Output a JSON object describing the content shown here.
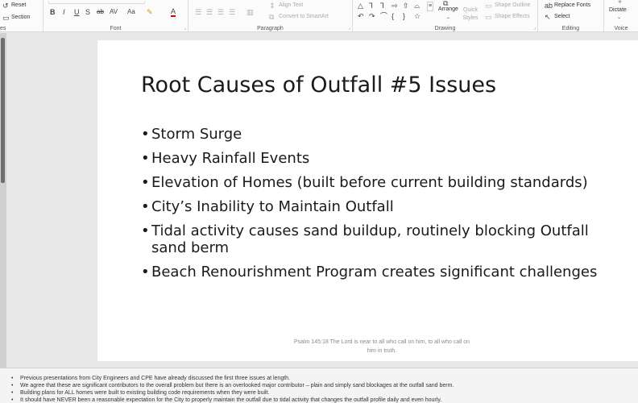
{
  "ribbon": {
    "slides_group": {
      "reset": "Reset",
      "section": "Section",
      "label_fragment": "es"
    },
    "font_group": {
      "label": "Font",
      "buttons": [
        "B",
        "I",
        "U",
        "S",
        "ab",
        "AV",
        "Aa",
        "A"
      ]
    },
    "paragraph_group": {
      "label": "Paragraph",
      "align_text": "Align Text",
      "convert_smartart": "Convert to SmartArt"
    },
    "drawing_group": {
      "label": "Drawing",
      "arrange": "Arrange",
      "quick_styles": "Quick Styles",
      "shape_outline": "Shape Outline",
      "shape_effects": "Shape Effects"
    },
    "editing_group": {
      "label": "Editing",
      "replace_fonts": "Replace Fonts",
      "select": "Select"
    },
    "voice_group": {
      "label": "Voice",
      "dictate": "Dictate"
    }
  },
  "slide": {
    "title": "Root Causes of Outfall #5 Issues",
    "bullets": [
      "Storm Surge",
      "Heavy Rainfall Events",
      "Elevation of Homes (built before current building standards)",
      "City’s Inability to Maintain Outfall",
      "Tidal activity causes sand buildup, routinely blocking Outfall sand berm",
      "Beach Renourishment Program creates significant challenges"
    ],
    "footer_quote": "Psalm 145:18 The Lord is near to all who call on him, to all who call on him in truth."
  },
  "notes": [
    "Previous presentations from City Engineers and CPE have already discussed the first three issues at length.",
    "We agree that these are significant contributors to the overall problem but there is an overlooked major contributor – plain and simply sand blockages at the outfall sand berm.",
    "Building plans for ALL homes were built to existing building code requirements when they were built.",
    "It should have NEVER been a reasonable expectation for the City to properly maintain the outfall due to tidal activity that changes the outfall profile daily and even hourly."
  ]
}
